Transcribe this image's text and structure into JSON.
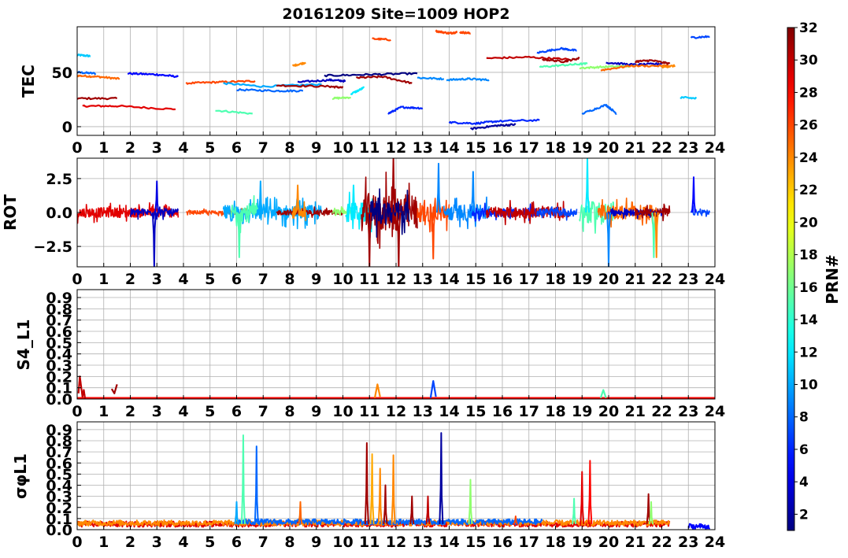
{
  "title": "20161209 Site=1009 HOP2",
  "colorbar": {
    "label": "PRN#",
    "range": [
      1,
      32
    ],
    "ticks": [
      2,
      4,
      6,
      8,
      10,
      12,
      14,
      16,
      18,
      20,
      22,
      24,
      26,
      28,
      30,
      32
    ],
    "colormap": "jet"
  },
  "chart_data": [
    {
      "type": "line",
      "ylabel": "TEC",
      "xlim": [
        0,
        24
      ],
      "ylim": [
        -8,
        92
      ],
      "yticks": [
        0,
        50
      ],
      "xticks": [
        0,
        1,
        2,
        3,
        4,
        5,
        6,
        7,
        8,
        9,
        10,
        11,
        12,
        13,
        14,
        15,
        16,
        17,
        18,
        19,
        20,
        21,
        22,
        23,
        24
      ],
      "grid": true,
      "series": [
        {
          "prn": 11,
          "x": [
            0.0,
            0.5
          ],
          "y": [
            66,
            65
          ]
        },
        {
          "prn": 8,
          "x": [
            0.0,
            0.7
          ],
          "y": [
            50,
            49
          ]
        },
        {
          "prn": 25,
          "x": [
            0.0,
            0.8,
            1.6
          ],
          "y": [
            47,
            46,
            44
          ]
        },
        {
          "prn": 31,
          "x": [
            0.0,
            1.5
          ],
          "y": [
            26,
            26
          ]
        },
        {
          "prn": 29,
          "x": [
            0.2,
            1.5,
            3.7
          ],
          "y": [
            19,
            19,
            16
          ]
        },
        {
          "prn": 5,
          "x": [
            1.9,
            3.0,
            3.8
          ],
          "y": [
            49,
            48,
            46
          ]
        },
        {
          "prn": 26,
          "x": [
            4.1,
            5.3,
            6.7
          ],
          "y": [
            40,
            41,
            42
          ]
        },
        {
          "prn": 15,
          "x": [
            5.2,
            6.6
          ],
          "y": [
            15,
            12
          ]
        },
        {
          "prn": 10,
          "x": [
            5.5,
            7.0,
            9.2
          ],
          "y": [
            40,
            37,
            39
          ]
        },
        {
          "prn": 8,
          "x": [
            6.0,
            7.5,
            8.5
          ],
          "y": [
            34,
            33,
            33
          ]
        },
        {
          "prn": 31,
          "x": [
            7.5,
            9.5,
            10.0
          ],
          "y": [
            38,
            37,
            36
          ]
        },
        {
          "prn": 3,
          "x": [
            8.3,
            9.5,
            10.1
          ],
          "y": [
            41,
            43,
            42
          ]
        },
        {
          "prn": 24,
          "x": [
            8.1,
            8.6
          ],
          "y": [
            56,
            59
          ]
        },
        {
          "prn": 17,
          "x": [
            9.6,
            10.3
          ],
          "y": [
            26,
            27
          ]
        },
        {
          "prn": 12,
          "x": [
            10.3,
            10.8
          ],
          "y": [
            30,
            36
          ]
        },
        {
          "prn": 1,
          "x": [
            9.3,
            11.0,
            12.8
          ],
          "y": [
            47,
            48,
            49
          ]
        },
        {
          "prn": 31,
          "x": [
            10.5,
            11.5,
            12.6
          ],
          "y": [
            45,
            46,
            40
          ]
        },
        {
          "prn": 26,
          "x": [
            11.1,
            11.8
          ],
          "y": [
            81,
            80
          ]
        },
        {
          "prn": 6,
          "x": [
            11.7,
            12.2,
            13.0
          ],
          "y": [
            12,
            18,
            17
          ]
        },
        {
          "prn": 9,
          "x": [
            12.8,
            13.8
          ],
          "y": [
            45,
            44
          ]
        },
        {
          "prn": 26,
          "x": [
            13.5,
            14.0,
            14.3
          ],
          "y": [
            88,
            86,
            87
          ]
        },
        {
          "prn": 26,
          "x": [
            14.4,
            14.8
          ],
          "y": [
            87,
            86
          ]
        },
        {
          "prn": 9,
          "x": [
            13.9,
            14.7,
            15.5
          ],
          "y": [
            43,
            44,
            43
          ]
        },
        {
          "prn": 6,
          "x": [
            14.0,
            15.0,
            15.8,
            17.4
          ],
          "y": [
            4,
            3,
            5,
            6
          ]
        },
        {
          "prn": 2,
          "x": [
            14.8,
            15.8,
            16.5
          ],
          "y": [
            -2,
            1,
            2
          ]
        },
        {
          "prn": 30,
          "x": [
            15.4,
            17.0,
            18.5
          ],
          "y": [
            63,
            64,
            62
          ]
        },
        {
          "prn": 7,
          "x": [
            17.3,
            18.2,
            18.8
          ],
          "y": [
            68,
            72,
            70
          ]
        },
        {
          "prn": 15,
          "x": [
            17.4,
            18.5,
            19.2
          ],
          "y": [
            55,
            57,
            58
          ]
        },
        {
          "prn": 31,
          "x": [
            17.5,
            18.3,
            18.9
          ],
          "y": [
            62,
            60,
            63
          ]
        },
        {
          "prn": 17,
          "x": [
            18.9,
            19.8,
            21.0
          ],
          "y": [
            54,
            55,
            56
          ]
        },
        {
          "prn": 8,
          "x": [
            19.0,
            19.9,
            20.3
          ],
          "y": [
            12,
            20,
            12
          ]
        },
        {
          "prn": 3,
          "x": [
            19.9,
            21.0,
            22.0
          ],
          "y": [
            59,
            57,
            58
          ]
        },
        {
          "prn": 25,
          "x": [
            19.7,
            20.8,
            22.3
          ],
          "y": [
            52,
            56,
            56
          ]
        },
        {
          "prn": 31,
          "x": [
            21.0,
            21.6,
            22.3
          ],
          "y": [
            60,
            61,
            58
          ]
        },
        {
          "prn": 24,
          "x": [
            22.0,
            22.5
          ],
          "y": [
            55,
            56
          ]
        },
        {
          "prn": 11,
          "x": [
            22.7,
            23.3
          ],
          "y": [
            27,
            26
          ]
        },
        {
          "prn": 7,
          "x": [
            23.1,
            23.8
          ],
          "y": [
            82,
            83
          ]
        }
      ]
    },
    {
      "type": "line",
      "ylabel": "ROT",
      "xlim": [
        0,
        24
      ],
      "ylim": [
        -4,
        4
      ],
      "yticks": [
        -2.5,
        0.0,
        2.5
      ],
      "xticks": [
        0,
        1,
        2,
        3,
        4,
        5,
        6,
        7,
        8,
        9,
        10,
        11,
        12,
        13,
        14,
        15,
        16,
        17,
        18,
        19,
        20,
        21,
        22,
        23,
        24
      ],
      "grid": true,
      "bands": [
        {
          "prn": 29,
          "x": [
            0.0,
            3.8
          ],
          "amplitude": 0.8
        },
        {
          "prn": 3,
          "x": [
            2.0,
            3.8
          ],
          "amplitude": 0.6
        },
        {
          "prn": 26,
          "x": [
            4.1,
            6.7
          ],
          "amplitude": 0.3
        },
        {
          "prn": 10,
          "x": [
            5.5,
            9.2
          ],
          "amplitude": 1.2
        },
        {
          "prn": 15,
          "x": [
            5.8,
            6.8
          ],
          "amplitude": 1.5
        },
        {
          "prn": 31,
          "x": [
            7.5,
            10.0
          ],
          "amplitude": 0.4
        },
        {
          "prn": 24,
          "x": [
            8.1,
            8.6
          ],
          "amplitude": 1.0
        },
        {
          "prn": 17,
          "x": [
            9.6,
            10.4
          ],
          "amplitude": 0.5
        },
        {
          "prn": 12,
          "x": [
            10.1,
            11.2
          ],
          "amplitude": 1.6
        },
        {
          "prn": 31,
          "x": [
            10.7,
            12.8
          ],
          "amplitude": 3.0
        },
        {
          "prn": 1,
          "x": [
            11.0,
            12.5
          ],
          "amplitude": 2.0
        },
        {
          "prn": 26,
          "x": [
            12.8,
            14.0
          ],
          "amplitude": 1.5
        },
        {
          "prn": 9,
          "x": [
            13.8,
            15.5
          ],
          "amplitude": 1.3
        },
        {
          "prn": 6,
          "x": [
            14.8,
            17.4
          ],
          "amplitude": 0.7
        },
        {
          "prn": 30,
          "x": [
            15.4,
            18.5
          ],
          "amplitude": 0.9
        },
        {
          "prn": 7,
          "x": [
            17.3,
            18.8
          ],
          "amplitude": 0.6
        },
        {
          "prn": 15,
          "x": [
            18.9,
            20.2
          ],
          "amplitude": 1.8
        },
        {
          "prn": 25,
          "x": [
            19.6,
            21.8
          ],
          "amplitude": 1.2
        },
        {
          "prn": 3,
          "x": [
            20.0,
            22.0
          ],
          "amplitude": 0.5
        },
        {
          "prn": 31,
          "x": [
            21.0,
            22.3
          ],
          "amplitude": 0.7
        },
        {
          "prn": 7,
          "x": [
            23.1,
            23.8
          ],
          "amplitude": 0.5
        }
      ],
      "spikes": [
        {
          "prn": 3,
          "x": 2.9,
          "y": -4.0
        },
        {
          "prn": 4,
          "x": 3.0,
          "y": 2.3
        },
        {
          "prn": 10,
          "x": 6.9,
          "y": 2.3
        },
        {
          "prn": 15,
          "x": 6.1,
          "y": -3.3
        },
        {
          "prn": 24,
          "x": 8.3,
          "y": 2.0
        },
        {
          "prn": 12,
          "x": 10.4,
          "y": 2.0
        },
        {
          "prn": 31,
          "x": 11.0,
          "y": -4.0
        },
        {
          "prn": 31,
          "x": 11.9,
          "y": 4.0
        },
        {
          "prn": 31,
          "x": 12.1,
          "y": -4.0
        },
        {
          "prn": 9,
          "x": 13.6,
          "y": 3.6
        },
        {
          "prn": 26,
          "x": 13.4,
          "y": -3.4
        },
        {
          "prn": 9,
          "x": 14.9,
          "y": 3.0
        },
        {
          "prn": 12,
          "x": 19.2,
          "y": 4.0
        },
        {
          "prn": 9,
          "x": 20.0,
          "y": -4.0
        },
        {
          "prn": 15,
          "x": 21.7,
          "y": -3.3
        },
        {
          "prn": 24,
          "x": 21.8,
          "y": -3.3
        },
        {
          "prn": 5,
          "x": 23.2,
          "y": 2.6
        }
      ]
    },
    {
      "type": "line",
      "ylabel": "S4_L1",
      "xlim": [
        0,
        24
      ],
      "ylim": [
        0,
        0.97
      ],
      "yticks": [
        0.0,
        0.1,
        0.2,
        0.3,
        0.4,
        0.5,
        0.6,
        0.7,
        0.8,
        0.9
      ],
      "xticks": [
        0,
        1,
        2,
        3,
        4,
        5,
        6,
        7,
        8,
        9,
        10,
        11,
        12,
        13,
        14,
        15,
        16,
        17,
        18,
        19,
        20,
        21,
        22,
        23,
        24
      ],
      "grid": true,
      "series": [
        {
          "prn": 28,
          "x": [
            0.0,
            24.0
          ],
          "y": [
            0.01,
            0.01
          ]
        },
        {
          "prn": 30,
          "x": [
            0.05,
            0.1,
            0.2,
            0.25,
            0.3
          ],
          "y": [
            0.05,
            0.2,
            0.02,
            0.08,
            0.0
          ]
        },
        {
          "prn": 31,
          "x": [
            1.3,
            1.4,
            1.5
          ],
          "y": [
            0.09,
            0.05,
            0.13
          ]
        },
        {
          "prn": 24,
          "x": [
            11.2,
            11.3,
            11.4
          ],
          "y": [
            0.01,
            0.13,
            0.02
          ]
        },
        {
          "prn": 7,
          "x": [
            13.3,
            13.4,
            13.5
          ],
          "y": [
            0.01,
            0.16,
            0.02
          ]
        },
        {
          "prn": 15,
          "x": [
            19.7,
            19.8,
            19.9
          ],
          "y": [
            0.01,
            0.08,
            0.01
          ]
        }
      ]
    },
    {
      "type": "line",
      "ylabel": "σφL1",
      "xlim": [
        0,
        24
      ],
      "ylim": [
        0,
        0.97
      ],
      "yticks": [
        0.0,
        0.1,
        0.2,
        0.3,
        0.4,
        0.5,
        0.6,
        0.7,
        0.8,
        0.9
      ],
      "xticks": [
        0,
        1,
        2,
        3,
        4,
        5,
        6,
        7,
        8,
        9,
        10,
        11,
        12,
        13,
        14,
        15,
        16,
        17,
        18,
        19,
        20,
        21,
        22,
        23,
        24
      ],
      "grid": true,
      "baselines": [
        {
          "prn": 29,
          "x": [
            0.0,
            22.3
          ],
          "level": 0.05
        },
        {
          "prn": 24,
          "x": [
            0.0,
            22.3
          ],
          "level": 0.06
        },
        {
          "prn": 8,
          "x": [
            6.0,
            17.5
          ],
          "level": 0.07
        },
        {
          "prn": 5,
          "x": [
            23.0,
            23.8
          ],
          "level": 0.03
        }
      ],
      "spikes": [
        {
          "prn": 15,
          "x": 6.25,
          "y": 0.85
        },
        {
          "prn": 8,
          "x": 6.75,
          "y": 0.75
        },
        {
          "prn": 10,
          "x": 6.0,
          "y": 0.25
        },
        {
          "prn": 25,
          "x": 8.4,
          "y": 0.25
        },
        {
          "prn": 31,
          "x": 10.9,
          "y": 0.78
        },
        {
          "prn": 23,
          "x": 11.1,
          "y": 0.68
        },
        {
          "prn": 24,
          "x": 11.4,
          "y": 0.55
        },
        {
          "prn": 24,
          "x": 11.9,
          "y": 0.67
        },
        {
          "prn": 31,
          "x": 11.6,
          "y": 0.4
        },
        {
          "prn": 31,
          "x": 12.6,
          "y": 0.3
        },
        {
          "prn": 2,
          "x": 13.7,
          "y": 0.87
        },
        {
          "prn": 30,
          "x": 13.2,
          "y": 0.3
        },
        {
          "prn": 17,
          "x": 14.8,
          "y": 0.45
        },
        {
          "prn": 29,
          "x": 19.0,
          "y": 0.52
        },
        {
          "prn": 28,
          "x": 19.3,
          "y": 0.62
        },
        {
          "prn": 31,
          "x": 21.5,
          "y": 0.32
        },
        {
          "prn": 17,
          "x": 21.6,
          "y": 0.25
        },
        {
          "prn": 15,
          "x": 18.7,
          "y": 0.28
        },
        {
          "prn": 26,
          "x": 16.5,
          "y": 0.12
        }
      ]
    }
  ]
}
